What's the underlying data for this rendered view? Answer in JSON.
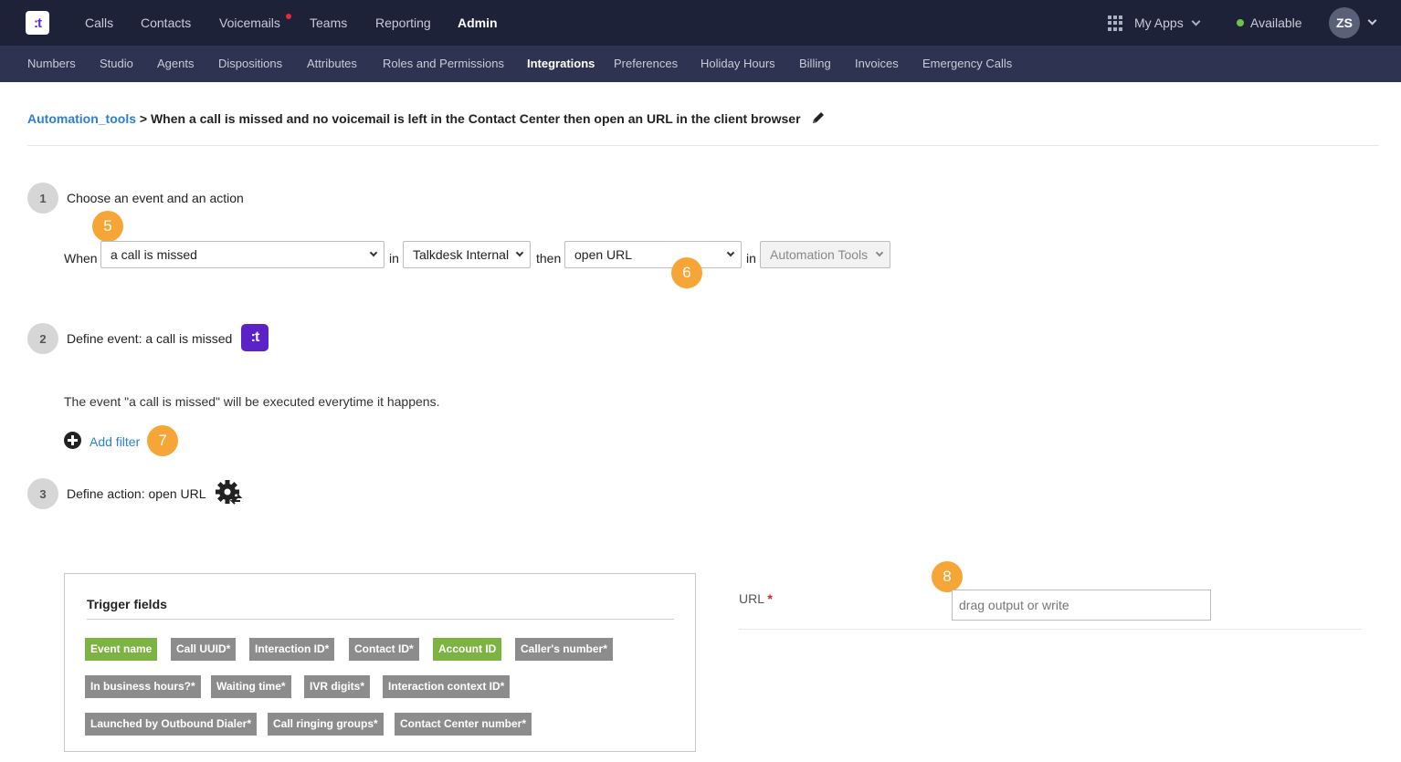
{
  "topnav": {
    "items": [
      {
        "label": "Calls"
      },
      {
        "label": "Contacts"
      },
      {
        "label": "Voicemails"
      },
      {
        "label": "Teams"
      },
      {
        "label": "Reporting"
      },
      {
        "label": "Admin"
      }
    ],
    "my_apps": "My Apps",
    "status": "Available",
    "avatar_initials": "ZS"
  },
  "subnav": {
    "items": [
      {
        "label": "Numbers"
      },
      {
        "label": "Studio"
      },
      {
        "label": "Agents"
      },
      {
        "label": "Dispositions"
      },
      {
        "label": "Attributes"
      },
      {
        "label": "Roles and Permissions"
      },
      {
        "label": "Integrations"
      },
      {
        "label": "Preferences"
      },
      {
        "label": "Holiday Hours"
      },
      {
        "label": "Billing"
      },
      {
        "label": "Invoices"
      },
      {
        "label": "Emergency Calls"
      }
    ]
  },
  "breadcrumb": {
    "link": "Automation_tools",
    "separator": ">",
    "title": "When a call is missed and no voicemail is left in the Contact Center then open an URL in the client browser"
  },
  "step1": {
    "number": "1",
    "label": "Choose an event and an action",
    "when_label": "When",
    "event_value": "a call is missed",
    "in_label": "in",
    "event_source": "Talkdesk Internal",
    "then_label": "then",
    "action_value": "open URL",
    "in_label2": "in",
    "action_target": "Automation Tools"
  },
  "step2": {
    "number": "2",
    "label": "Define event: a call is missed",
    "description": "The event \"a call is missed\" will be executed everytime it happens.",
    "add_filter": "Add filter"
  },
  "step3": {
    "number": "3",
    "label": "Define action: open URL"
  },
  "badges": {
    "b5": "5",
    "b6": "6",
    "b7": "7",
    "b8": "8"
  },
  "trigger": {
    "title": "Trigger fields",
    "chips": [
      {
        "label": "Event name",
        "color": "#7cb342"
      },
      {
        "label": "Call UUID*",
        "color": "#8c8c8c"
      },
      {
        "label": "Interaction ID*",
        "color": "#8c8c8c"
      },
      {
        "label": "Contact ID*",
        "color": "#8c8c8c"
      },
      {
        "label": "Account ID",
        "color": "#7cb342"
      },
      {
        "label": "Caller's number*",
        "color": "#8c8c8c"
      },
      {
        "label": "In business hours?*",
        "color": "#8c8c8c"
      },
      {
        "label": "Waiting time*",
        "color": "#8c8c8c"
      },
      {
        "label": "IVR digits*",
        "color": "#8c8c8c"
      },
      {
        "label": "Interaction context ID*",
        "color": "#8c8c8c"
      },
      {
        "label": "Launched by Outbound Dialer*",
        "color": "#8c8c8c"
      },
      {
        "label": "Call ringing groups*",
        "color": "#8c8c8c"
      },
      {
        "label": "Contact Center number*",
        "color": "#8c8c8c"
      }
    ]
  },
  "url_field": {
    "label": "URL",
    "required_mark": "*",
    "placeholder": "drag output or write"
  },
  "colors": {
    "topbar": "#1d2238",
    "subbar": "#2d3350",
    "link": "#2d7fd3",
    "badge": "#f5a636",
    "brand": "#5b22c8",
    "chip_green": "#7cb342",
    "chip_gray": "#8c8c8c"
  }
}
